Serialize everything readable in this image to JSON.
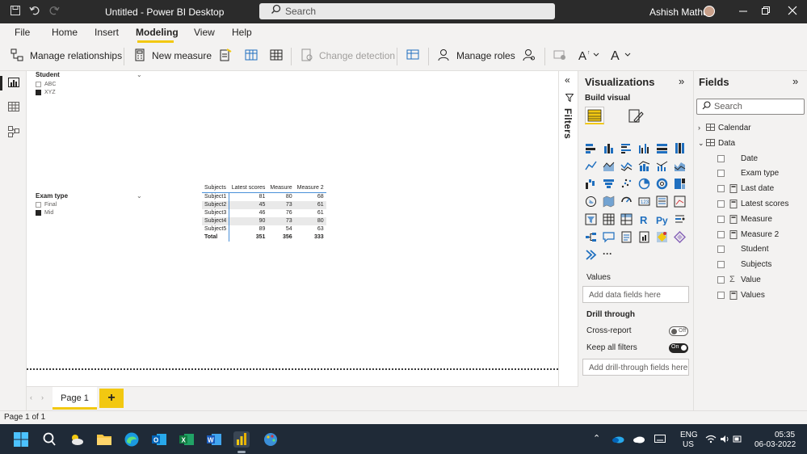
{
  "window": {
    "title": "Untitled - Power BI Desktop",
    "search_placeholder": "Search",
    "user_name": "Ashish Mathur"
  },
  "menu": {
    "items": [
      "File",
      "Home",
      "Insert",
      "Modeling",
      "View",
      "Help"
    ],
    "active": "Modeling"
  },
  "ribbon": {
    "manage_relationships": "Manage relationships",
    "new_measure": "New measure",
    "change_detection": "Change detection",
    "manage_roles": "Manage roles"
  },
  "canvas": {
    "slicer_student": {
      "title": "Student",
      "options": [
        {
          "label": "ABC",
          "checked": false
        },
        {
          "label": "XYZ",
          "checked": true
        }
      ]
    },
    "slicer_exam": {
      "title": "Exam type",
      "options": [
        {
          "label": "Final",
          "checked": false
        },
        {
          "label": "Mid",
          "checked": true
        }
      ]
    },
    "matrix": {
      "headers": [
        "Subjects",
        "Latest scores",
        "Measure",
        "Measure 2"
      ],
      "rows": [
        [
          "Subject1",
          "81",
          "80",
          "68"
        ],
        [
          "Subject2",
          "45",
          "73",
          "61"
        ],
        [
          "Subject3",
          "46",
          "76",
          "61"
        ],
        [
          "Subject4",
          "90",
          "73",
          "80"
        ],
        [
          "Subject5",
          "89",
          "54",
          "63"
        ]
      ],
      "total": [
        "Total",
        "351",
        "356",
        "333"
      ]
    }
  },
  "pages": {
    "tabs": [
      "Page 1"
    ],
    "add_label": "+",
    "status": "Page 1 of 1"
  },
  "filters": {
    "label": "Filters"
  },
  "visualizations": {
    "title": "Visualizations",
    "build_visual": "Build visual",
    "values_label": "Values",
    "values_placeholder": "Add data fields here",
    "drill_through": "Drill through",
    "cross_report": "Cross-report",
    "cross_report_state": "Off",
    "keep_all_filters": "Keep all filters",
    "keep_all_filters_state": "On",
    "drill_placeholder": "Add drill-through fields here",
    "more": "···"
  },
  "fields": {
    "title": "Fields",
    "search_placeholder": "Search",
    "tables": [
      {
        "name": "Calendar",
        "expanded": false
      },
      {
        "name": "Data",
        "expanded": true
      }
    ],
    "items": [
      {
        "name": "Date",
        "icon": "none"
      },
      {
        "name": "Exam type",
        "icon": "none"
      },
      {
        "name": "Last date",
        "icon": "calculator-icon"
      },
      {
        "name": "Latest scores",
        "icon": "calculator-icon"
      },
      {
        "name": "Measure",
        "icon": "calculator-icon"
      },
      {
        "name": "Measure 2",
        "icon": "calculator-icon"
      },
      {
        "name": "Student",
        "icon": "none"
      },
      {
        "name": "Subjects",
        "icon": "none"
      },
      {
        "name": "Value",
        "icon": "sigma-icon"
      },
      {
        "name": "Values",
        "icon": "calculator-icon"
      }
    ]
  },
  "taskbar": {
    "lang": "ENG",
    "region": "US",
    "time": "05:35",
    "date": "06-03-2022"
  },
  "colors": {
    "accent": "#f2c811",
    "titlebar": "#2b2b2b",
    "pane": "#f3f2f1",
    "taskbar": "#1f2a37"
  }
}
